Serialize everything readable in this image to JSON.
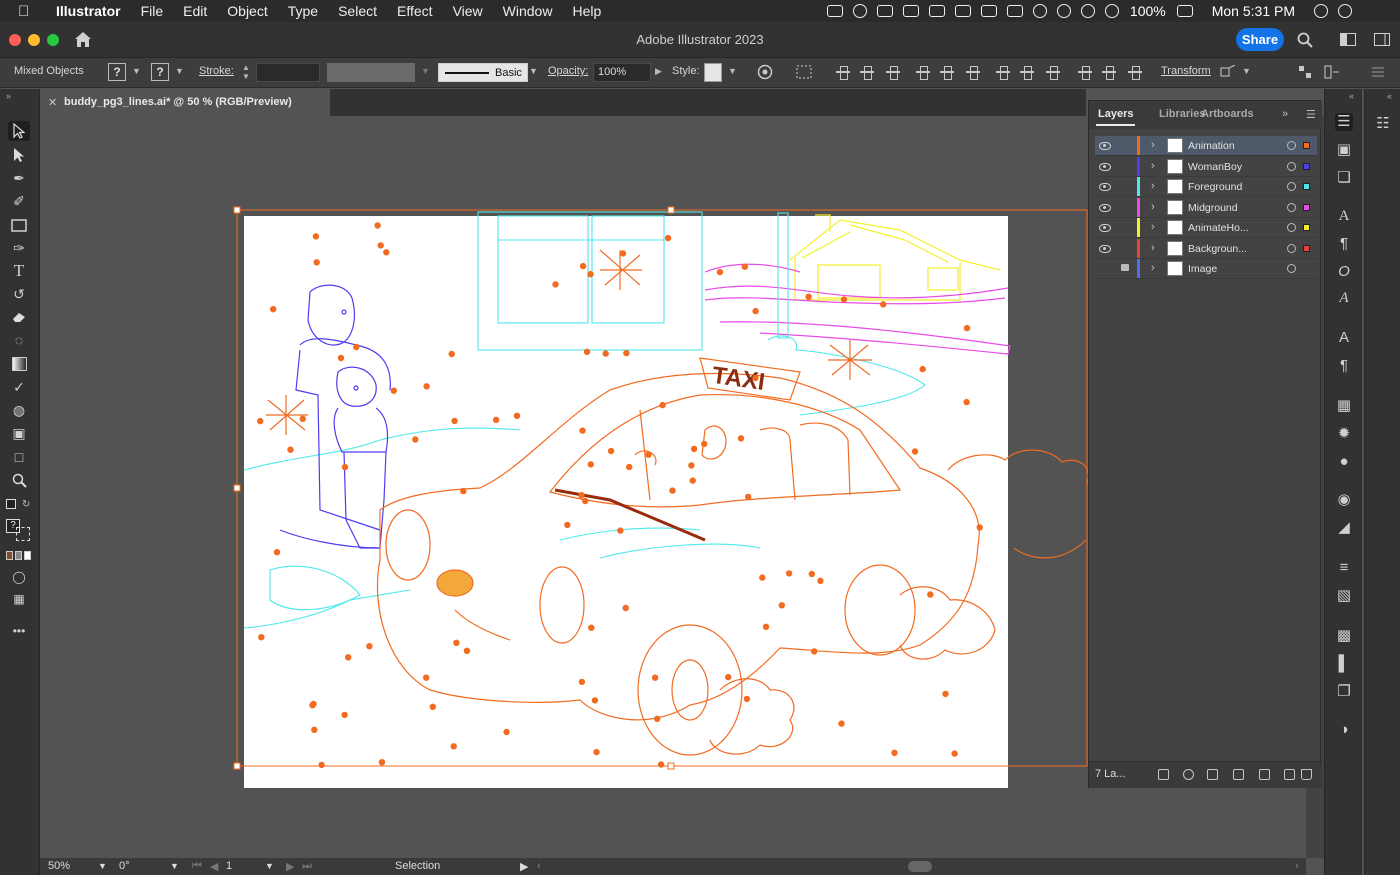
{
  "menubar": {
    "app_name": "Illustrator",
    "items": [
      "File",
      "Edit",
      "Object",
      "Type",
      "Select",
      "Effect",
      "View",
      "Window",
      "Help"
    ],
    "battery": "100%",
    "clock": "Mon 5:31 PM"
  },
  "window": {
    "title": "Adobe Illustrator 2023",
    "share_label": "Share"
  },
  "control_bar": {
    "selection_label": "Mixed Objects",
    "stroke_label": "Stroke:",
    "brush_label": "Basic",
    "opacity_label": "Opacity:",
    "opacity_value": "100%",
    "style_label": "Style:",
    "transform_label": "Transform",
    "unknown_mark": "?"
  },
  "document": {
    "tab_title": "buddy_pg3_lines.ai* @ 50 % (RGB/Preview)"
  },
  "layers_panel": {
    "tabs": [
      "Layers",
      "Libraries",
      "Artboards"
    ],
    "layers": [
      {
        "name": "Animation",
        "color": "#f26b21",
        "visible": true,
        "locked": false,
        "selected": true
      },
      {
        "name": "WomanBoy",
        "color": "#4d3df2",
        "visible": true,
        "locked": false,
        "selected": false
      },
      {
        "name": "Foreground",
        "color": "#4ee8ea",
        "visible": true,
        "locked": false,
        "selected": false
      },
      {
        "name": "Midground",
        "color": "#e84de8",
        "visible": true,
        "locked": false,
        "selected": false
      },
      {
        "name": "AnimateHo...",
        "color": "#f4ef2a",
        "visible": true,
        "locked": false,
        "selected": false
      },
      {
        "name": "Backgroun...",
        "color": "#e8423a",
        "visible": true,
        "locked": false,
        "selected": false
      },
      {
        "name": "Image",
        "color": "#4f6ff0",
        "visible": false,
        "locked": true,
        "selected": false
      }
    ],
    "footer_count": "7 La..."
  },
  "artwork": {
    "taxi_sign": "TAXI"
  },
  "status_bar": {
    "zoom": "50%",
    "rotation": "0°",
    "artboard_index": "1",
    "tool_name": "Selection"
  },
  "colors": {
    "accent": "#1473e6",
    "selection_orange": "#f26b21",
    "artboard_bg": "#ffffff",
    "ui_dark": "#323232"
  }
}
